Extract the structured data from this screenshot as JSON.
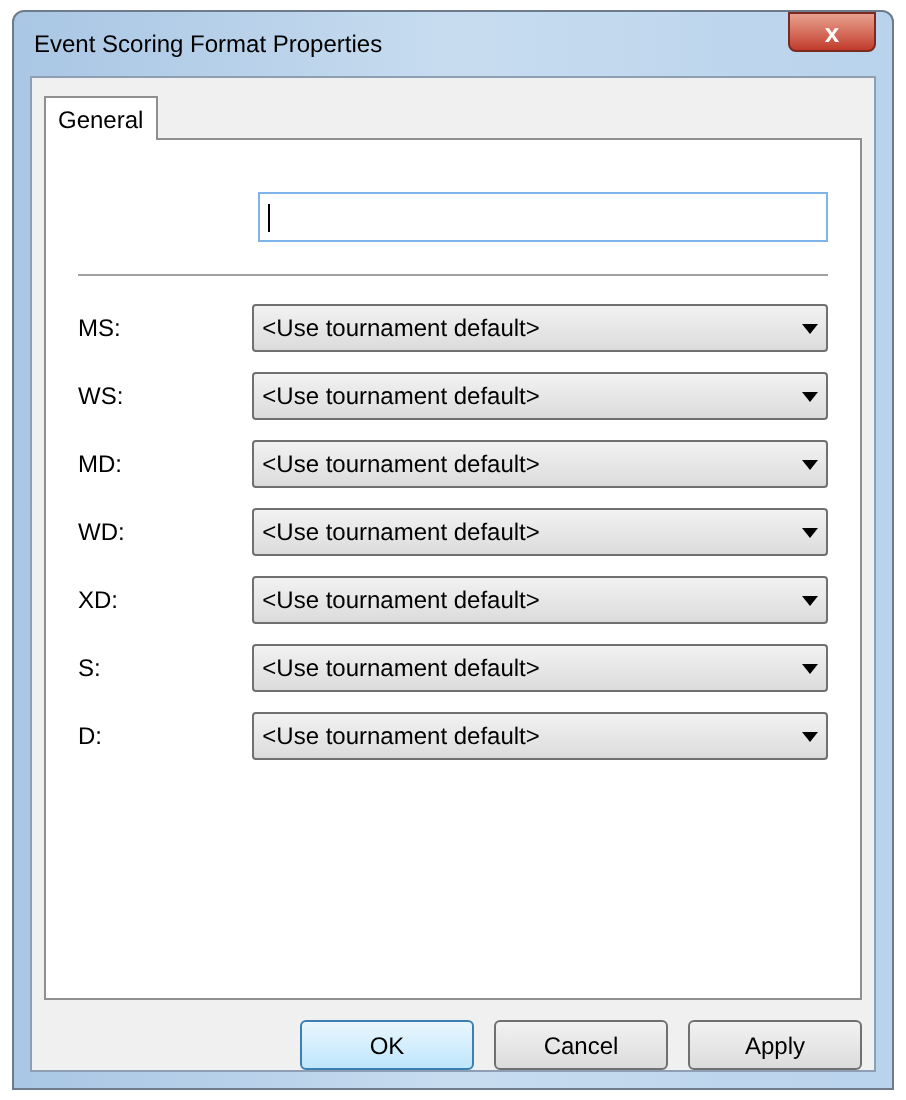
{
  "window": {
    "title": "Event Scoring Format Properties",
    "close_glyph": "x"
  },
  "tabs": [
    {
      "label": "General",
      "selected": true
    }
  ],
  "rows": [
    {
      "label": "MS:",
      "value": "<Use tournament default>"
    },
    {
      "label": "WS:",
      "value": "<Use tournament default>"
    },
    {
      "label": "MD:",
      "value": "<Use tournament default>"
    },
    {
      "label": "WD:",
      "value": "<Use tournament default>"
    },
    {
      "label": "XD:",
      "value": "<Use tournament default>"
    },
    {
      "label": "S:",
      "value": "<Use tournament default>"
    },
    {
      "label": "D:",
      "value": "<Use tournament default>"
    }
  ],
  "buttons": [
    {
      "label": "OK",
      "default": true
    },
    {
      "label": "Cancel",
      "default": false
    },
    {
      "label": "Apply",
      "default": false
    }
  ]
}
